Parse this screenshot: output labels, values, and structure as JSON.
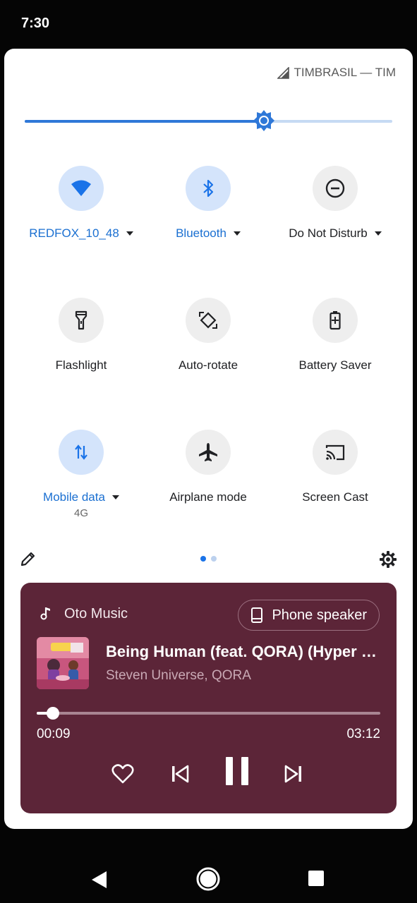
{
  "status_bar": {
    "time": "7:30"
  },
  "carrier": {
    "name": "TIMBRASIL — TIM",
    "icon": "signal-icon"
  },
  "brightness": {
    "level": 0.65,
    "icon": "brightness-icon"
  },
  "tiles": [
    {
      "id": "wifi",
      "label": "REDFOX_10_48",
      "icon": "wifi-icon",
      "active": true,
      "has_dropdown": true
    },
    {
      "id": "bluetooth",
      "label": "Bluetooth",
      "icon": "bluetooth-icon",
      "active": true,
      "has_dropdown": true
    },
    {
      "id": "dnd",
      "label": "Do Not Disturb",
      "icon": "do-not-disturb-icon",
      "active": false,
      "has_dropdown": true
    },
    {
      "id": "flashlight",
      "label": "Flashlight",
      "icon": "flashlight-icon",
      "active": false
    },
    {
      "id": "autorotate",
      "label": "Auto-rotate",
      "icon": "auto-rotate-icon",
      "active": false
    },
    {
      "id": "battery",
      "label": "Battery Saver",
      "icon": "battery-saver-icon",
      "active": false
    },
    {
      "id": "mobile",
      "label": "Mobile data",
      "sublabel": "4G",
      "icon": "mobile-data-icon",
      "active": true,
      "has_dropdown": true
    },
    {
      "id": "airplane",
      "label": "Airplane mode",
      "icon": "airplane-icon",
      "active": false
    },
    {
      "id": "cast",
      "label": "Screen Cast",
      "icon": "cast-icon",
      "active": false
    }
  ],
  "page_indicator": {
    "pages": 2,
    "current": 1
  },
  "media": {
    "app_name": "Oto Music",
    "output_label": "Phone speaker",
    "title": "Being Human (feat. QORA) (Hyper Potions Remix)",
    "artist": "Steven Universe, QORA",
    "elapsed": "00:09",
    "total": "03:12",
    "progress": 0.047,
    "background": "#5c2538"
  },
  "colors": {
    "accent": "#1a73e8",
    "active_tile": "#d4e4fb",
    "inactive_tile": "#eeeeee"
  }
}
